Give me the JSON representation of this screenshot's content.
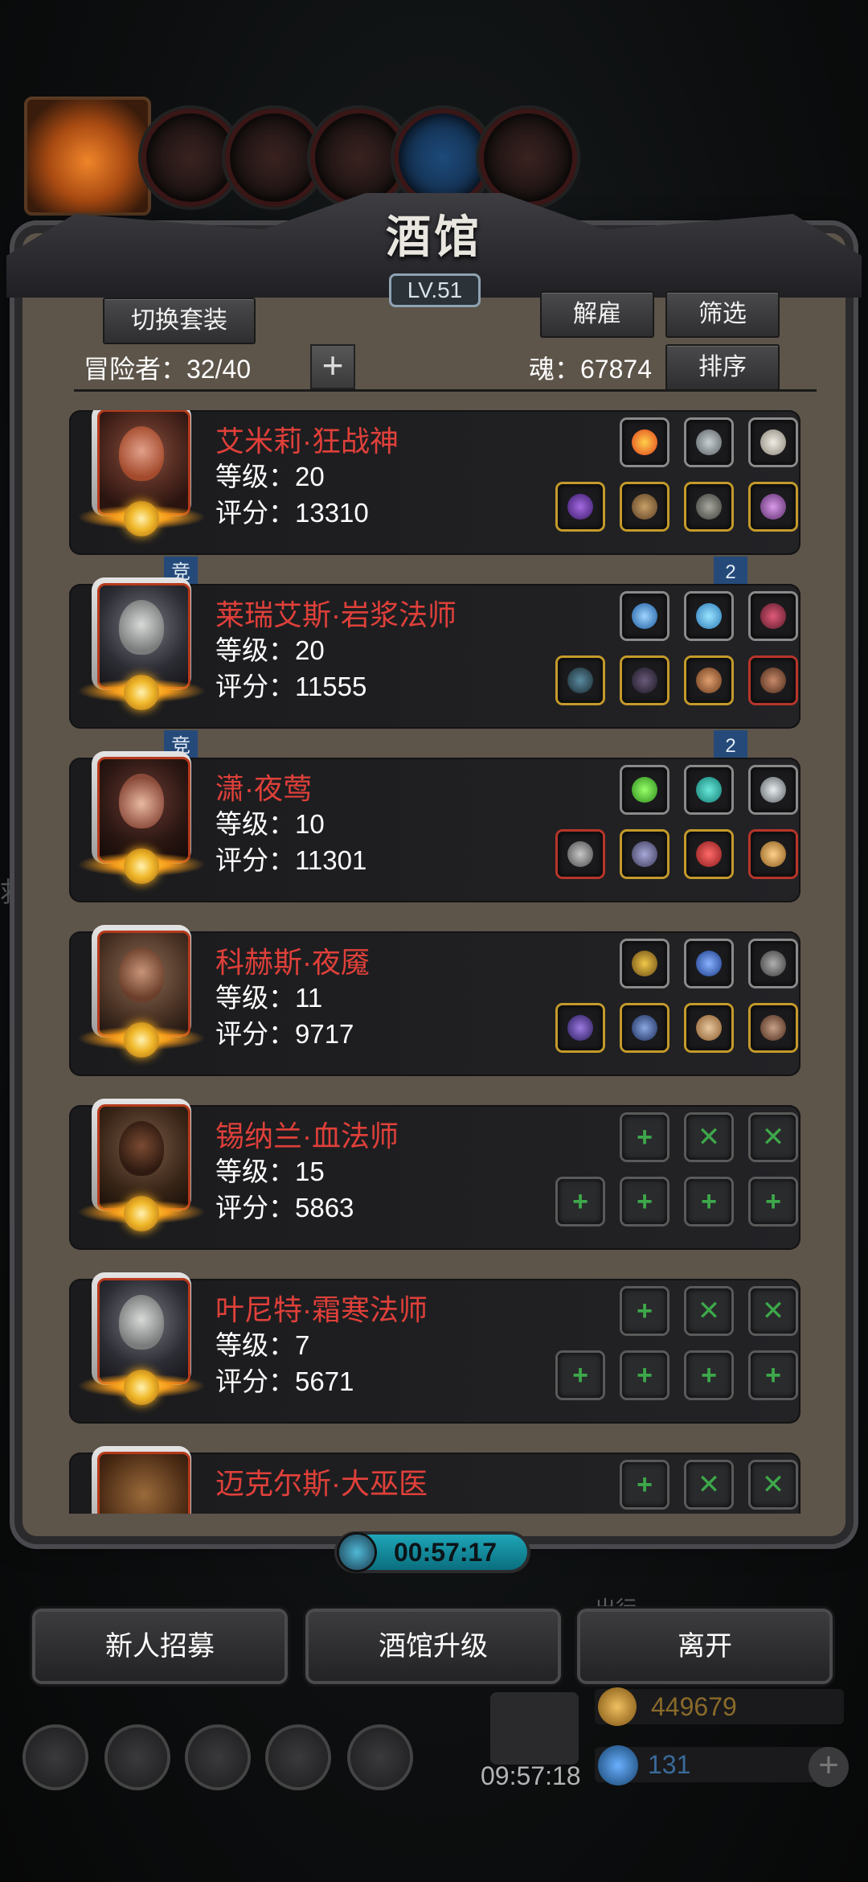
{
  "window": {
    "title": "酒馆",
    "level": "LV.51"
  },
  "toolbar": {
    "switch_outfit": "切换套装",
    "dismiss": "解雇",
    "filter": "筛选",
    "sort": "排序"
  },
  "stats": {
    "adventurers_label": "冒险者：32/40",
    "soul_label": "魂：67874"
  },
  "heroes": [
    {
      "name": "艾米莉·狂战神",
      "level": "等级：20",
      "score": "评分：13310"
    },
    {
      "name": "莱瑞艾斯·岩浆法师",
      "level": "等级：20",
      "score": "评分：11555"
    },
    {
      "name": "潇·夜莺",
      "level": "等级：10",
      "score": "评分：11301"
    },
    {
      "name": "科赫斯·夜魇",
      "level": "等级：11",
      "score": "评分：9717"
    },
    {
      "name": "锡纳兰·血法师",
      "level": "等级：15",
      "score": "评分：5863"
    },
    {
      "name": "叶尼特·霜寒法师",
      "level": "等级：7",
      "score": "评分：5671"
    },
    {
      "name": "迈克尔斯·大巫医",
      "level": "",
      "score": ""
    }
  ],
  "links": [
    {
      "left": "竞",
      "right": "2"
    },
    {
      "left": "竞",
      "right": "2"
    }
  ],
  "timer": "00:57:17",
  "bottom_buttons": {
    "recruit": "新人招募",
    "upgrade": "酒馆升级",
    "leave": "离开"
  },
  "background": {
    "gold": "449679",
    "gems": "131",
    "gift_timer": "09:57:18",
    "partial_text": "出行",
    "left_partial": "救"
  },
  "colors": {
    "hero_name": "#e0403a",
    "accent_teal": "#1ea6b8",
    "panel": "#5d544a"
  }
}
